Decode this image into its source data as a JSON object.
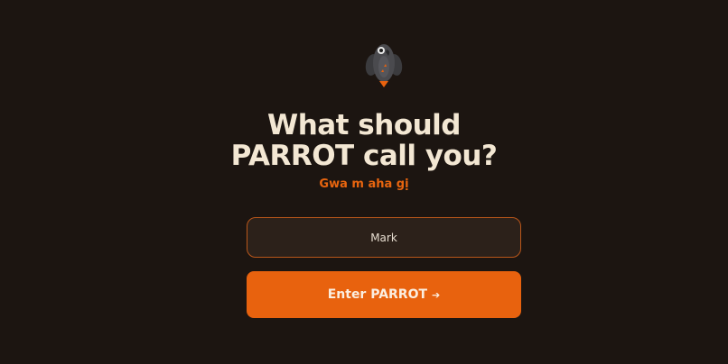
{
  "header": {
    "logo_icon": "parrot-icon",
    "title_line1": "What should",
    "title_line2": "PARROT call you?",
    "subtitle": "Gwa m aha gị"
  },
  "form": {
    "name_value": "Mark",
    "submit_label": "Enter PARROT",
    "submit_icon": "arrow-right-icon",
    "submit_icon_glyph": "➔"
  },
  "colors": {
    "background": "#1c1511",
    "accent": "#e8620e",
    "title_text": "#f3e7d3",
    "input_background": "#2c211a",
    "input_border": "#b9561a"
  }
}
